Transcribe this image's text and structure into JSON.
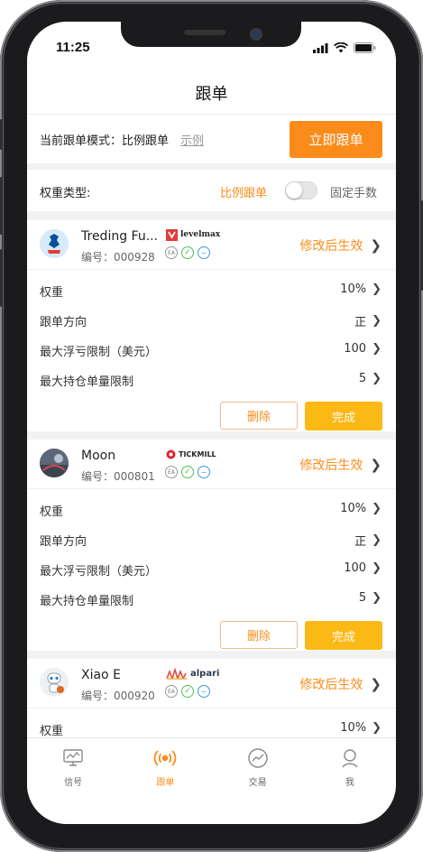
{
  "status": {
    "time": "11:25"
  },
  "nav": {
    "title": "跟单"
  },
  "mode": {
    "label": "当前跟单模式：比例跟单",
    "example": "示例",
    "follow_btn": "立即跟单"
  },
  "weight": {
    "label": "权重类型:",
    "option_a": "比例跟单",
    "option_b": "固定手数",
    "toggle_on": false
  },
  "colors": {
    "accent": "#fb8c1a",
    "done_button": "#fcb814"
  },
  "cards": [
    {
      "name": "Treding Fu...",
      "code": "编号：000928",
      "broker": "levelmax",
      "effect": "修改后生效",
      "rows": [
        {
          "key": "权重",
          "value": "10%"
        },
        {
          "key": "跟单方向",
          "value": "正"
        },
        {
          "key": "最大浮亏限制（美元）",
          "value": "100"
        },
        {
          "key": "最大持仓单量限制",
          "value": "5"
        }
      ],
      "delete": "删除",
      "done": "完成"
    },
    {
      "name": "Moon",
      "code": "编号：000801",
      "broker": "TICKMILL",
      "effect": "修改后生效",
      "rows": [
        {
          "key": "权重",
          "value": "10%"
        },
        {
          "key": "跟单方向",
          "value": "正"
        },
        {
          "key": "最大浮亏限制（美元）",
          "value": "100"
        },
        {
          "key": "最大持仓单量限制",
          "value": "5"
        }
      ],
      "delete": "删除",
      "done": "完成"
    },
    {
      "name": "Xiao E",
      "code": "编号：000920",
      "broker": "alpari",
      "effect": "修改后生效",
      "rows": [
        {
          "key": "权重",
          "value": "10%"
        }
      ]
    }
  ],
  "tabs": [
    {
      "label": "信号",
      "icon": "monitor-icon",
      "active": false
    },
    {
      "label": "跟单",
      "icon": "broadcast-icon",
      "active": true
    },
    {
      "label": "交易",
      "icon": "trend-chart-icon",
      "active": false
    },
    {
      "label": "我",
      "icon": "user-icon",
      "active": false
    }
  ]
}
